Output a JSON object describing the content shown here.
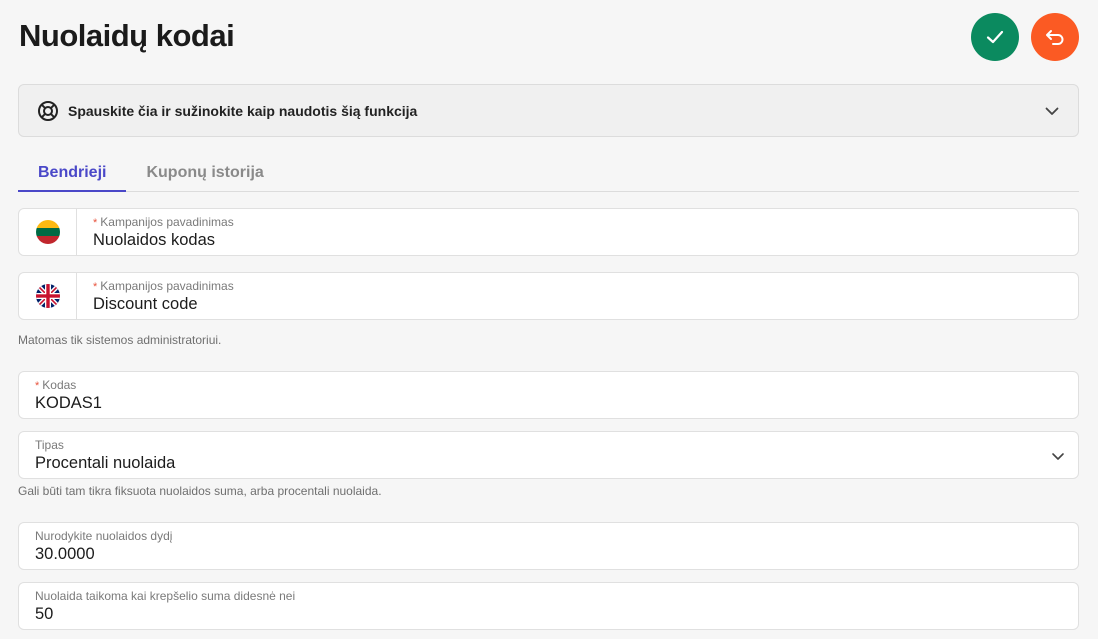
{
  "header": {
    "title": "Nuolaidų kodai",
    "colors": {
      "save": "#0b8a5f",
      "back": "#fb5a23",
      "accent": "#4a48c8"
    }
  },
  "help": {
    "text": "Spauskite čia ir sužinokite kaip naudotis šią funkcija",
    "icon": "lifebuoy-icon"
  },
  "tabs": [
    {
      "label": "Bendrieji",
      "active": true
    },
    {
      "label": "Kuponų istorija",
      "active": false
    }
  ],
  "campaign_names": {
    "lt": {
      "label": "Kampanijos pavadinimas",
      "value": "Nuolaidos kodas",
      "flag": "lithuania-flag-icon"
    },
    "en": {
      "label": "Kampanijos pavadinimas",
      "value": "Discount code",
      "flag": "uk-flag-icon"
    },
    "hint": "Matomas tik sistemos administratoriui."
  },
  "code": {
    "label": "Kodas",
    "value": "KODAS1"
  },
  "type": {
    "label": "Tipas",
    "value": "Procentali nuolaida",
    "hint": "Gali būti tam tikra fiksuota nuolaidos suma, arba procentali nuolaida."
  },
  "discount_size": {
    "label": "Nurodykite nuolaidos dydį",
    "value": "30.0000"
  },
  "min_cart": {
    "label": "Nuolaida taikoma kai krepšelio suma didesnė nei",
    "value": "50"
  },
  "required_mark": "*"
}
